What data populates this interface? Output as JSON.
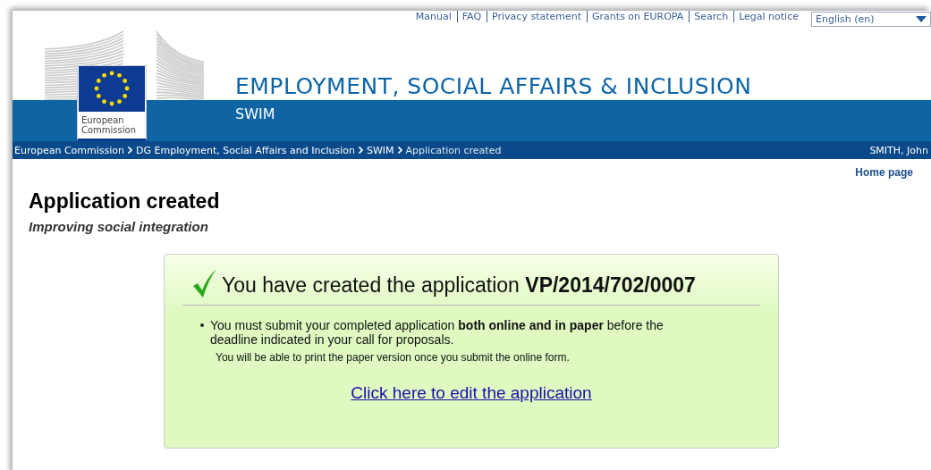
{
  "top_links": [
    "Manual",
    "FAQ",
    "Privacy statement",
    "Grants on EUROPA",
    "Search",
    "Legal notice"
  ],
  "language_select": {
    "value": "English (en)"
  },
  "logo": {
    "text": "European Commission"
  },
  "header": {
    "title": "EMPLOYMENT, SOCIAL AFFAIRS & INCLUSION",
    "subtitle": "SWIM"
  },
  "breadcrumb": [
    {
      "label": "European Commission",
      "link": true
    },
    {
      "label": "DG Employment, Social Affairs and Inclusion",
      "link": true
    },
    {
      "label": "SWIM",
      "link": true
    },
    {
      "label": "Application created",
      "link": false
    }
  ],
  "user": "SMITH, John",
  "home_link": "Home page",
  "page_title": "Application created",
  "page_subtitle": "Improving social integration",
  "message": {
    "heading": "You have created the application **VP/2014/702/0007**",
    "bullets": [
      "You must submit your completed application **both online and in paper** before the deadline indicated in your call for proposals."
    ],
    "note": "You will be able to print the paper version once you submit the online form.",
    "link": "Click here to edit the application"
  }
}
